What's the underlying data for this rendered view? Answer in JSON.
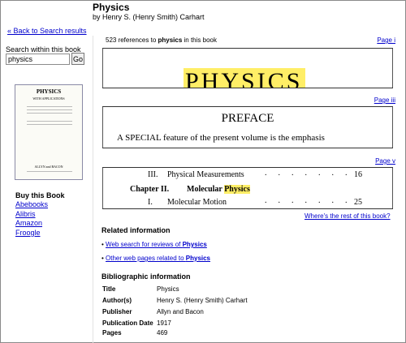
{
  "book": {
    "title": "Physics",
    "author": "by Henry S. (Henry Smith) Carhart"
  },
  "nav": {
    "back_label": "« Back to Search results"
  },
  "search": {
    "label": "Search within this book",
    "value": "physics",
    "go_label": "Go"
  },
  "cover": {
    "title": "PHYSICS",
    "subtitle": "WITH APPLICATIONS",
    "publisher": "ALLYN and BACON"
  },
  "buy": {
    "title": "Buy this Book",
    "links": [
      "Abebooks",
      "Alibris",
      "Amazon",
      "Froogle"
    ]
  },
  "results": {
    "refs_prefix": "523 references to ",
    "refs_term": "physics",
    "refs_suffix": " in this book",
    "snippets": [
      {
        "page": "Page i",
        "text": "PHYSICS"
      },
      {
        "page": "Page iii",
        "heading": "PREFACE",
        "text": "A SPECIAL feature of the present volume is the emphasis"
      },
      {
        "page": "Page v",
        "line1_num": "III.",
        "line1": "Physical Measurements",
        "line1_page": "16",
        "line2_prefix": "Chapter II.",
        "line2": "Molecular ",
        "line2_hl": "Physics",
        "line3_num": "I.",
        "line3": "Molecular Motion",
        "line3_page": "25"
      }
    ],
    "rest_link": "Where's the rest of this book?"
  },
  "related": {
    "title": "Related information",
    "items": [
      {
        "prefix": "Web search for reviews of ",
        "term": "Physics"
      },
      {
        "prefix": "Other web pages related to ",
        "term": "Physics"
      }
    ]
  },
  "biblio": {
    "title": "Bibliographic information",
    "rows": [
      {
        "key": "Title",
        "value": "Physics"
      },
      {
        "key": "Author(s)",
        "value": "Henry S. (Henry Smith) Carhart"
      },
      {
        "key": "Publisher",
        "value": "Allyn and Bacon"
      },
      {
        "key": "Publication Date",
        "value": "1917"
      },
      {
        "key": "Pages",
        "value": "469"
      }
    ]
  }
}
